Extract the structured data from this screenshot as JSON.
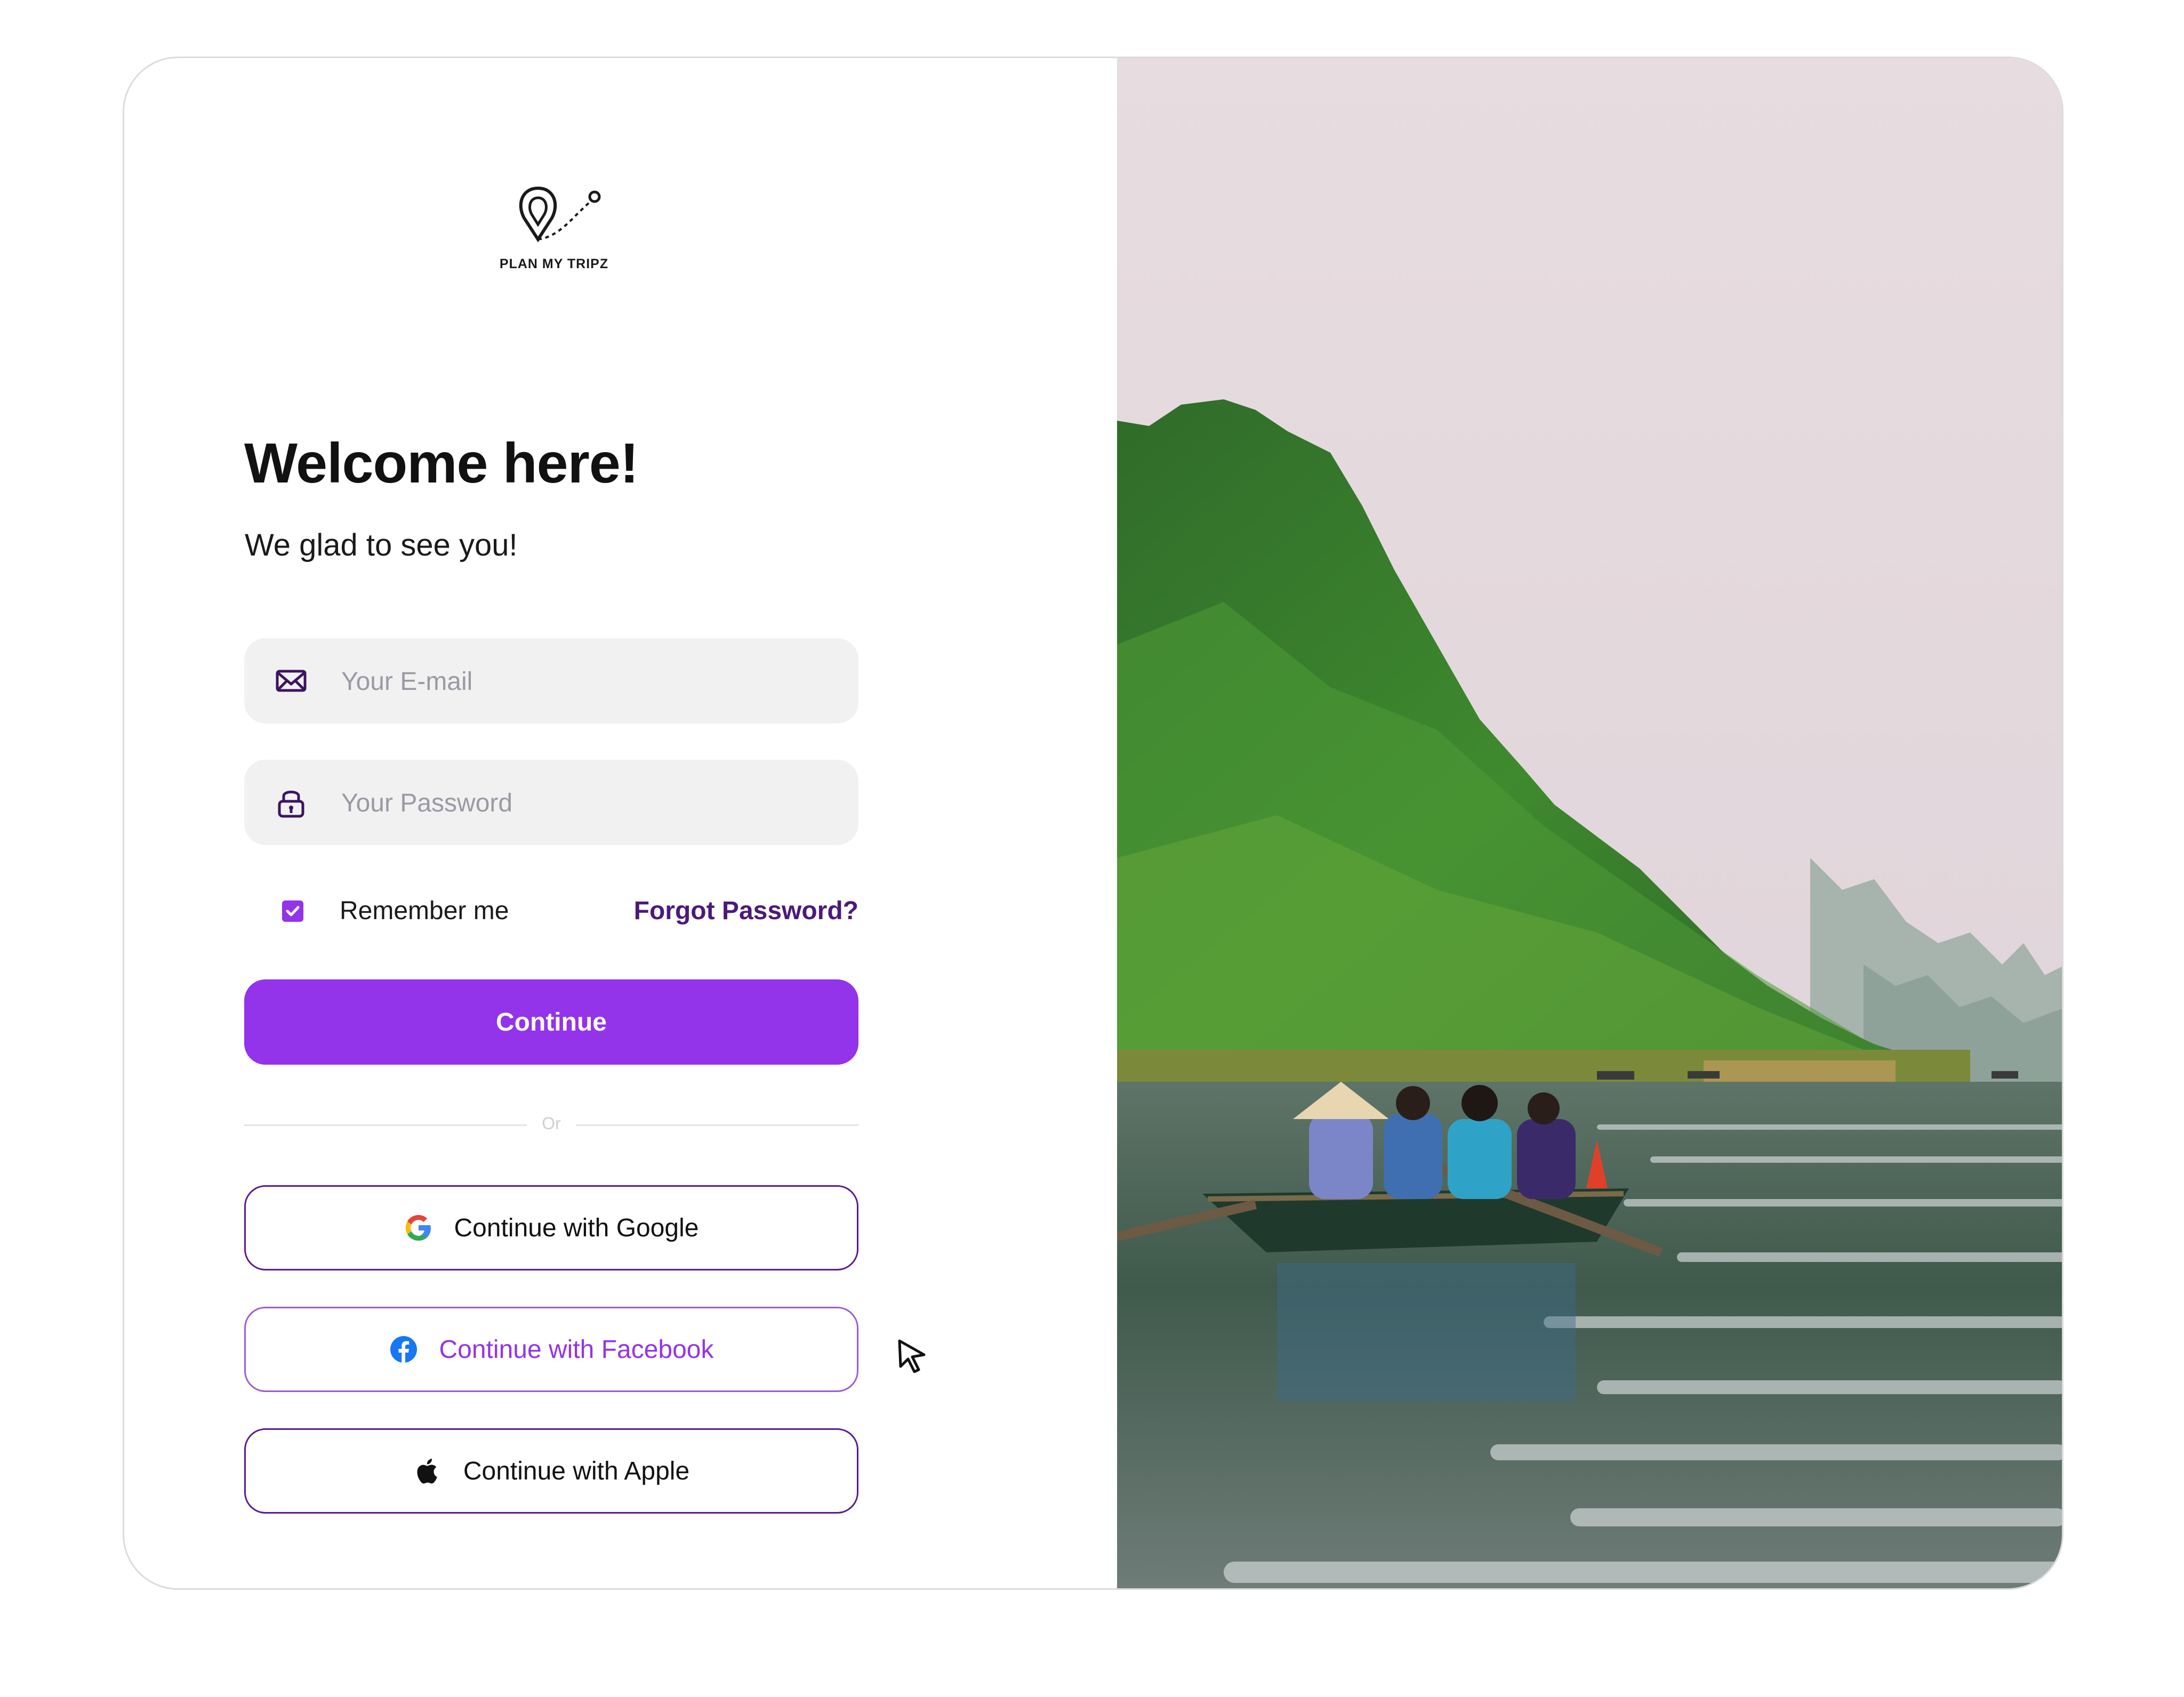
{
  "brand": {
    "name": "PLAN MY TRIPZ"
  },
  "login": {
    "title": "Welcome here!",
    "subtitle": "We glad to see you!",
    "email_placeholder": "Your E-mail",
    "password_placeholder": "Your Password",
    "remember_label": "Remember me",
    "remember_checked": true,
    "forgot_label": "Forgot Password?",
    "continue_label": "Continue",
    "divider_text": "Or"
  },
  "social": {
    "google_label": "Continue with Google",
    "facebook_label": "Continue with Facebook",
    "apple_label": "Continue with Apple"
  },
  "colors": {
    "accent": "#9333ea",
    "dark_accent": "#4b1a7a",
    "field_bg": "#f1f1f2"
  },
  "icons": {
    "email": "mail-icon",
    "password": "lock-icon",
    "google": "google-icon",
    "facebook": "facebook-icon",
    "apple": "apple-icon",
    "cursor": "mouse-cursor-icon"
  },
  "hero_image": {
    "subject": "river boat with passengers beside green limestone mountain"
  }
}
